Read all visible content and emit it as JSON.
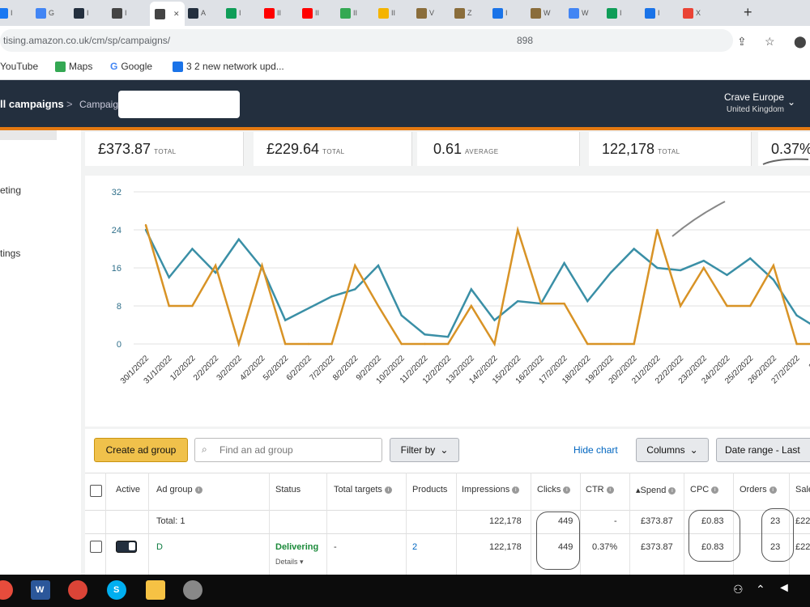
{
  "browser": {
    "tabs": [
      {
        "label": "I",
        "favicon_color": "#1877f2"
      },
      {
        "label": "G",
        "favicon_color": "#4285f4"
      },
      {
        "label": "I",
        "favicon_color": "#232f3e"
      },
      {
        "label": "I",
        "favicon_color": "#444444"
      },
      {
        "label": "",
        "favicon_color": "#444444",
        "active": true
      },
      {
        "label": "A",
        "favicon_color": "#232f3e"
      },
      {
        "label": "I",
        "favicon_color": "#0f9d58"
      },
      {
        "label": "II",
        "favicon_color": "#ff0000"
      },
      {
        "label": "II",
        "favicon_color": "#ff0000"
      },
      {
        "label": "II",
        "favicon_color": "#34a853"
      },
      {
        "label": "II",
        "favicon_color": "#f4b400"
      },
      {
        "label": "V",
        "favicon_color": "#8a6d3b"
      },
      {
        "label": "Z",
        "favicon_color": "#8a6d3b"
      },
      {
        "label": "I",
        "favicon_color": "#1a73e8"
      },
      {
        "label": "W",
        "favicon_color": "#8a6d3b"
      },
      {
        "label": "W",
        "favicon_color": "#4285f4"
      },
      {
        "label": "I",
        "favicon_color": "#0f9d58"
      },
      {
        "label": "I",
        "favicon_color": "#1a73e8"
      },
      {
        "label": "X",
        "favicon_color": "#ea4335"
      }
    ],
    "new_tab": "+",
    "url": "tising.amazon.co.uk/cm/sp/campaigns/",
    "url_tail": "898",
    "bookmarks": [
      {
        "label": "YouTube",
        "icon_color": "#ff0000"
      },
      {
        "label": "Maps",
        "icon_color": "#34a853"
      },
      {
        "label": "Google",
        "icon_color": "#4285f4"
      },
      {
        "label": "3 2 new network upd...",
        "icon_color": "#1a73e8"
      }
    ]
  },
  "header": {
    "crumb_all": "ll campaigns",
    "crumb_sep": ">",
    "crumb_campaign": "Campaign",
    "account_name": "Crave Europe",
    "account_market": "United Kingdom"
  },
  "nav": {
    "items": [
      "eting",
      "tings"
    ]
  },
  "metrics": [
    {
      "value": "£373.87",
      "label": "TOTAL"
    },
    {
      "value": "£229.64",
      "label": "TOTAL"
    },
    {
      "value": "0.61",
      "label": "AVERAGE"
    },
    {
      "value": "122,178",
      "label": "TOTAL"
    },
    {
      "value": "0.37%",
      "label": ""
    }
  ],
  "chart_data": {
    "type": "line",
    "x": [
      "30/1/2022",
      "31/1/2022",
      "1/2/2022",
      "2/2/2022",
      "3/2/2022",
      "4/2/2022",
      "5/2/2022",
      "6/2/2022",
      "7/2/2022",
      "8/2/2022",
      "9/2/2022",
      "10/2/2022",
      "11/2/2022",
      "12/2/2022",
      "13/2/2022",
      "14/2/2022",
      "15/2/2022",
      "16/2/2022",
      "17/2/2022",
      "18/2/2022",
      "19/2/2022",
      "20/2/2022",
      "21/2/2022",
      "22/2/2022",
      "23/2/2022",
      "24/2/2022",
      "25/2/2022",
      "26/2/2022",
      "27/2/2022",
      "28/2"
    ],
    "series": [
      {
        "color": "#3a8fa6",
        "values": [
          24,
          14,
          20,
          15,
          22,
          16,
          5,
          7.5,
          10,
          11.5,
          16.5,
          6,
          2,
          1.5,
          11.5,
          5,
          9,
          8.5,
          17,
          9,
          15,
          20,
          16,
          15.5,
          17.5,
          14.5,
          18,
          13.5,
          6,
          3
        ]
      },
      {
        "color": "#d89326",
        "values": [
          25,
          8,
          8,
          16.5,
          0,
          16.5,
          0,
          0,
          0,
          16.5,
          8,
          0,
          0,
          0,
          8,
          0,
          24,
          8.5,
          8.5,
          0,
          0,
          0,
          24,
          8,
          16,
          8,
          8,
          16.5,
          0,
          0
        ]
      }
    ],
    "yticks": [
      0,
      8,
      16,
      24,
      32
    ],
    "ylim": [
      0,
      32
    ]
  },
  "toolbar": {
    "create_label": "Create ad group",
    "search_placeholder": "Find an ad group",
    "filter_label": "Filter by",
    "hide_chart": "Hide chart",
    "columns_label": "Columns",
    "date_range_label": "Date range - Last"
  },
  "table": {
    "headers": [
      "Active",
      "Ad group",
      "Status",
      "Total targets",
      "Products",
      "Impressions",
      "Clicks",
      "CTR",
      "Spend",
      "CPC",
      "Orders",
      "Sale"
    ],
    "total_row": {
      "label": "Total: 1",
      "impressions": "122,178",
      "clicks": "449",
      "ctr": "-",
      "spend": "£373.87",
      "cpc": "£0.83",
      "orders": "23",
      "sales": "£22"
    },
    "rows": [
      {
        "ad_group": "D",
        "status": "Delivering",
        "details": "Details",
        "total_targets": "-",
        "products": "2",
        "impressions": "122,178",
        "clicks": "449",
        "ctr": "0.37%",
        "spend": "£373.87",
        "cpc": "£0.83",
        "orders": "23",
        "sales": "£22"
      }
    ]
  },
  "taskbar": {
    "word_label": "W",
    "skype_label": "S"
  }
}
